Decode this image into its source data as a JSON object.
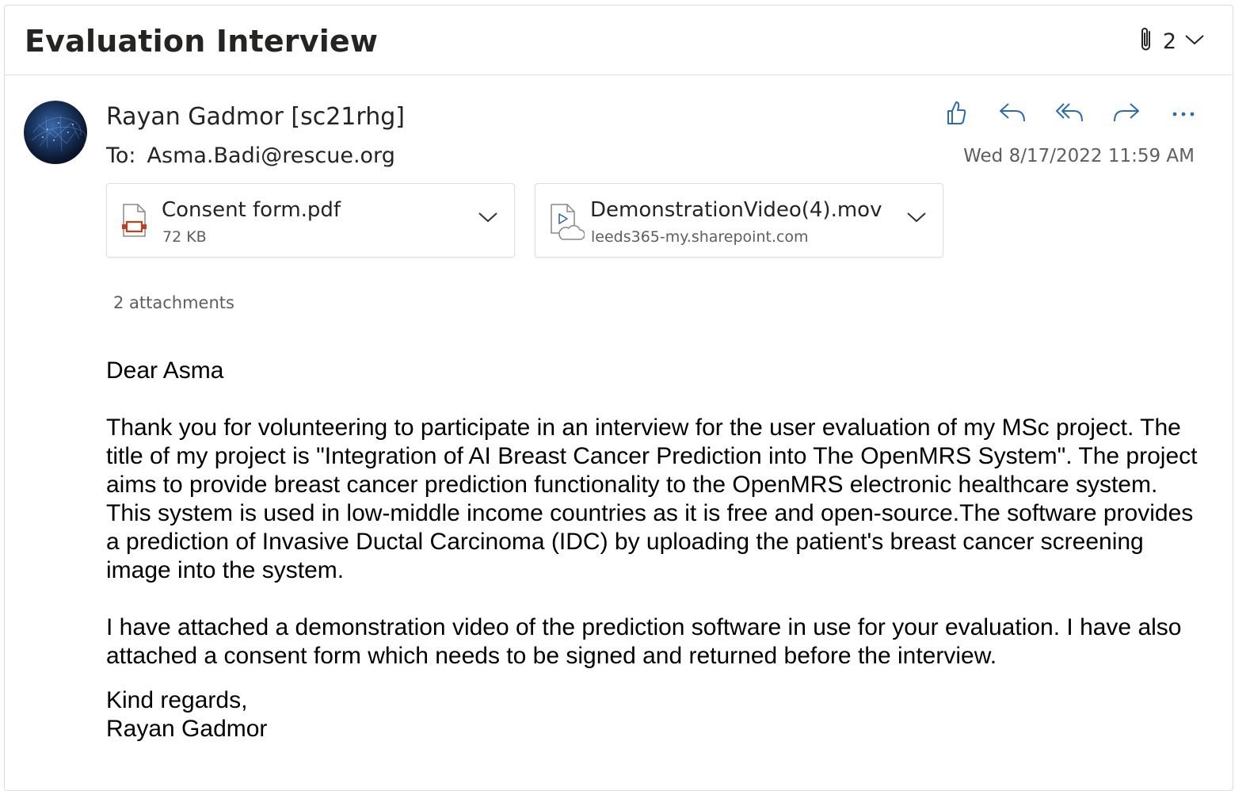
{
  "email": {
    "subject": "Evaluation Interview",
    "attachment_summary_count": "2",
    "sender": "Rayan Gadmor [sc21rhg]",
    "to_label": "To:",
    "to_address": "Asma.Badi@rescue.org",
    "date": "Wed 8/17/2022 11:59 AM",
    "actions": [
      "like-icon",
      "reply-icon",
      "reply-all-icon",
      "forward-icon",
      "more-icon"
    ]
  },
  "attachments": [
    {
      "name": "Consent form.pdf",
      "meta": "72 KB",
      "icon": "pdf-file-icon"
    },
    {
      "name": "DemonstrationVideo(4).mov",
      "meta": "leeds365-my.sharepoint.com",
      "icon": "cloud-video-file-icon"
    }
  ],
  "attachments_count_text": "2 attachments",
  "body": {
    "greeting": "Dear Asma",
    "paragraph1": "Thank you for volunteering to participate in an interview for the user evaluation of my MSc project. The title of my project is \"Integration of AI Breast Cancer Prediction into The OpenMRS System\". The project aims to provide breast cancer prediction functionality to the OpenMRS electronic healthcare system. This system is used in low-middle income countries as it is free and open-source.The software provides a prediction of Invasive Ductal Carcinoma (IDC) by uploading the patient's breast cancer screening image into the system.",
    "paragraph2": "I have attached a demonstration video of the prediction software in use for your evaluation. I have also attached a consent form which needs to be signed and returned before the interview.",
    "closing": "Kind regards,",
    "signature": "Rayan Gadmor"
  },
  "colors": {
    "accent": "#2b6cb0",
    "pdf_red": "#c43e1c",
    "muted": "#605e5c"
  }
}
